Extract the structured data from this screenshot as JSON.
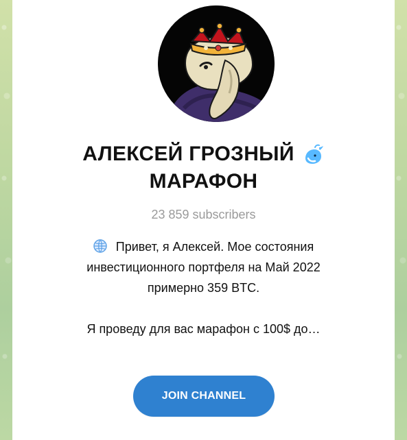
{
  "channel": {
    "title_line1": "АЛЕКСЕЙ ГРОЗНЫЙ",
    "title_line2": "МАРАФОН",
    "subscribers": "23 859 subscribers",
    "badge_icon": "whale-emoji-icon",
    "avatar_icon": "avatar-image",
    "description": {
      "line1": "Привет, я Алексей. Мое состояния",
      "line2": "инвестиционного портфеля на Май 2022",
      "line3": "примерно 359 BTC.",
      "line4": "Я проведу для вас марафон с 100$ до…",
      "leading_icon": "globe-emoji-icon"
    },
    "join_label": "JOIN CHANNEL"
  },
  "colors": {
    "primary_button": "#2f81d0",
    "text": "#111111",
    "subtext": "#9a9a9a",
    "avatar_bg": "#050505"
  }
}
